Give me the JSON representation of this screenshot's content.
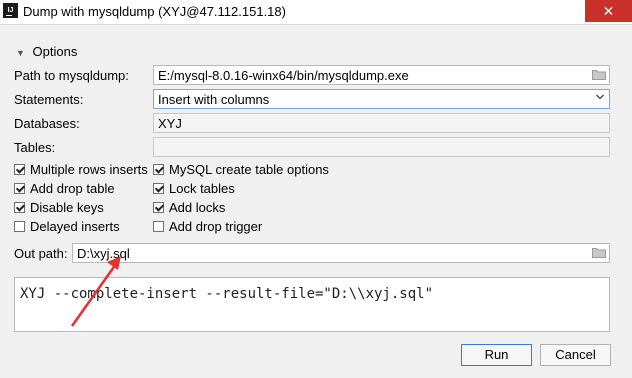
{
  "window": {
    "title": "Dump with mysqldump (XYJ@47.112.151.18)",
    "close_glyph": "✕",
    "icon_letters": "IJ",
    "colors": {
      "close_bg": "#c7312a",
      "accent": "#3b7ad0",
      "annotation_arrow": "#e53030"
    }
  },
  "section": {
    "label": "Options",
    "state": "expanded"
  },
  "form": {
    "path_label": "Path to mysqldump:",
    "path_value": "E:/mysql-8.0.16-winx64/bin/mysqldump.exe",
    "statements_label": "Statements:",
    "statements_value": "Insert with columns",
    "databases_label": "Databases:",
    "databases_value": "XYJ",
    "tables_label": "Tables:",
    "tables_value": ""
  },
  "options": [
    {
      "label": "Multiple rows inserts",
      "checked": true
    },
    {
      "label": "MySQL create table options",
      "checked": true
    },
    {
      "label": "Add drop table",
      "checked": true
    },
    {
      "label": "Lock tables",
      "checked": true
    },
    {
      "label": "Disable keys",
      "checked": true
    },
    {
      "label": "Add locks",
      "checked": true
    },
    {
      "label": "Delayed inserts",
      "checked": false
    },
    {
      "label": "Add drop trigger",
      "checked": false
    }
  ],
  "output": {
    "label": "Out path:",
    "value": "D:\\xyj.sql"
  },
  "command": "XYJ --complete-insert --result-file=\"D:\\\\xyj.sql\"",
  "buttons": {
    "run": "Run",
    "cancel": "Cancel"
  }
}
